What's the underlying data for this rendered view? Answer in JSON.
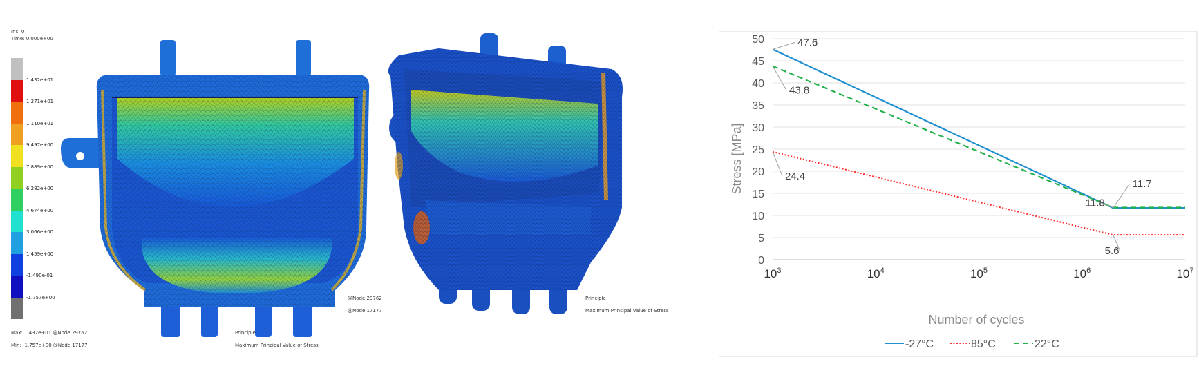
{
  "fea_left": {
    "inc_label": "Inc:  0",
    "time_label": "Time:  0.000e+00",
    "legend_values": [
      "1.432e+01",
      "1.271e+01",
      "1.110e+01",
      "9.497e+00",
      "7.889e+00",
      "6.282e+00",
      "4.674e+00",
      "3.066e+00",
      "1.459e+00",
      "-1.490e-01",
      "-1.757e+00"
    ],
    "legend_colors": [
      "#c0c0c0",
      "#e01010",
      "#f07010",
      "#f0a020",
      "#f0e020",
      "#90d020",
      "#30d060",
      "#20e0d0",
      "#20a0e0",
      "#1040e0",
      "#1010c0",
      "#707070"
    ],
    "max_text": "Max: 1.432e+01 @Node  29762",
    "min_text": "Min: -1.757e+00 @Node  17177",
    "title_1": "Principle",
    "title_2": "Maximum Principal Value of Stress"
  },
  "fea_right": {
    "node_max": "@Node  29762",
    "node_min": "@Node  17177",
    "title_1": "Principle",
    "title_2": "Maximum Principal Value of Stress"
  },
  "chart_data": {
    "type": "line",
    "xlabel": "Number of cycles",
    "ylabel": "Stress [MPa]",
    "x_scale": "log",
    "xlim": [
      1000,
      10000000
    ],
    "ylim": [
      0,
      50
    ],
    "y_ticks": [
      "0",
      "5",
      "10",
      "15",
      "20",
      "25",
      "30",
      "35",
      "40",
      "45",
      "50"
    ],
    "x_ticks": [
      {
        "base": "10",
        "exp": "3"
      },
      {
        "base": "10",
        "exp": "4"
      },
      {
        "base": "10",
        "exp": "5"
      },
      {
        "base": "10",
        "exp": "6"
      },
      {
        "base": "10",
        "exp": "7"
      }
    ],
    "grid": "horizontal",
    "legend_position": "bottom",
    "series": [
      {
        "name": "-27°C",
        "color": "#1f8fd0",
        "style": "solid",
        "x": [
          1000,
          2000000,
          10000000
        ],
        "y": [
          47.6,
          11.7,
          11.7
        ]
      },
      {
        "name": "85°C",
        "color": "#ff2a2a",
        "style": "dotted",
        "x": [
          1000,
          2000000,
          10000000
        ],
        "y": [
          24.4,
          5.6,
          5.6
        ]
      },
      {
        "name": "22°C",
        "color": "#22b24c",
        "style": "dashed",
        "x": [
          1000,
          2000000,
          10000000
        ],
        "y": [
          43.8,
          11.8,
          11.8
        ]
      }
    ],
    "annotations": [
      {
        "text": "47.6",
        "x": 1000,
        "y": 47.6
      },
      {
        "text": "43.8",
        "x": 1000,
        "y": 43.8
      },
      {
        "text": "24.4",
        "x": 1000,
        "y": 24.4
      },
      {
        "text": "11.7",
        "x": 2000000,
        "y": 11.7
      },
      {
        "text": "11.8",
        "x": 2000000,
        "y": 11.8
      },
      {
        "text": "5.6",
        "x": 2000000,
        "y": 5.6
      }
    ]
  }
}
